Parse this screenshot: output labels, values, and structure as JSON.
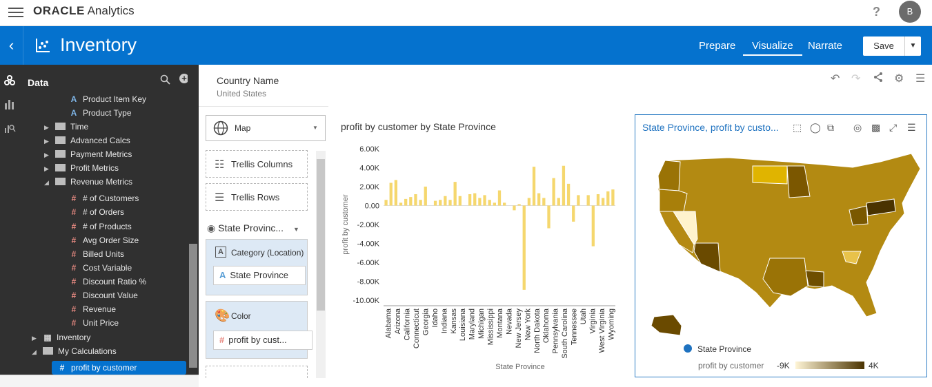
{
  "topbar": {
    "brand_bold": "ORACLE",
    "brand_rest": " Analytics",
    "help": "?",
    "avatar": "B"
  },
  "header": {
    "title": "Inventory",
    "tabs": [
      {
        "label": "Prepare"
      },
      {
        "label": "Visualize"
      },
      {
        "label": "Narrate"
      }
    ],
    "save_label": "Save"
  },
  "data_panel": {
    "title": "Data",
    "items": [
      {
        "label": "Product Item Key",
        "type": "attr"
      },
      {
        "label": "Product Type",
        "type": "attr"
      },
      {
        "label": "Time",
        "type": "folder"
      },
      {
        "label": "Advanced Calcs",
        "type": "folder"
      },
      {
        "label": "Payment Metrics",
        "type": "folder"
      },
      {
        "label": "Profit Metrics",
        "type": "folder"
      },
      {
        "label": "Revenue Metrics",
        "type": "folder-open"
      },
      {
        "label": "# of Customers",
        "type": "measure"
      },
      {
        "label": "# of Orders",
        "type": "measure"
      },
      {
        "label": "# of Products",
        "type": "measure"
      },
      {
        "label": "Avg Order Size",
        "type": "measure"
      },
      {
        "label": "Billed Units",
        "type": "measure"
      },
      {
        "label": "Cost Variable",
        "type": "measure"
      },
      {
        "label": "Discount Ratio %",
        "type": "measure"
      },
      {
        "label": "Discount Value",
        "type": "measure"
      },
      {
        "label": "Revenue",
        "type": "measure"
      },
      {
        "label": "Unit Price",
        "type": "measure"
      },
      {
        "label": "Inventory",
        "type": "dataset"
      },
      {
        "label": "My Calculations",
        "type": "folder-open"
      },
      {
        "label": "profit by customer",
        "type": "measure-selected"
      }
    ]
  },
  "filter": {
    "label": "Country Name",
    "value": "United States"
  },
  "grammar": {
    "viz_type": "Map",
    "trellis_columns": "Trellis Columns",
    "trellis_rows": "Trellis Rows",
    "layer": "State Provinc...",
    "category_label": "Category (Location)",
    "category_value": "State Province",
    "color_label": "Color",
    "color_value": "profit by cust..."
  },
  "chart_data": [
    {
      "type": "bar",
      "title": "profit by customer by State Province",
      "xlabel": "State Province",
      "ylabel": "profit by customer",
      "ylim": [
        -10000,
        6000
      ],
      "yticks": [
        "6.00K",
        "4.00K",
        "2.00K",
        "0.00",
        "-2.00K",
        "-4.00K",
        "-6.00K",
        "-8.00K",
        "-10.00K"
      ],
      "categories": [
        "Alabama",
        "Arizona",
        "California",
        "Connecticut",
        "Georgia",
        "Idaho",
        "Indiana",
        "Kansas",
        "Louisiana",
        "Maryland",
        "Michigan",
        "Mississippi",
        "Montana",
        "Nevada",
        "New Jersey",
        "New York",
        "North Dakota",
        "Oklahoma",
        "Pennsylvania",
        "South Carolina",
        "Tennessee",
        "Utah",
        "Virginia",
        "West Virginia",
        "Wyoming"
      ],
      "values": [
        600,
        2400,
        2700,
        300,
        700,
        900,
        1200,
        600,
        2000,
        0,
        500,
        600,
        1000,
        600,
        2500,
        1000,
        0,
        1200,
        1300,
        800,
        1100,
        600,
        300,
        1600,
        300,
        0,
        -500,
        150,
        -8900,
        800,
        4100,
        1300,
        800,
        -2400,
        2900,
        800,
        4200,
        2300,
        -1700,
        1100,
        0,
        1100,
        -4300,
        1200,
        800,
        1500,
        1700
      ],
      "bar_color": "#f5d76e"
    },
    {
      "type": "map",
      "title": "State Province, profit by custo...",
      "legend_shape": "State Province",
      "legend_measure": "profit by customer",
      "legend_min": "-9K",
      "legend_max": "4K",
      "color_low": "#fff5d6",
      "color_high": "#4a3300"
    }
  ]
}
